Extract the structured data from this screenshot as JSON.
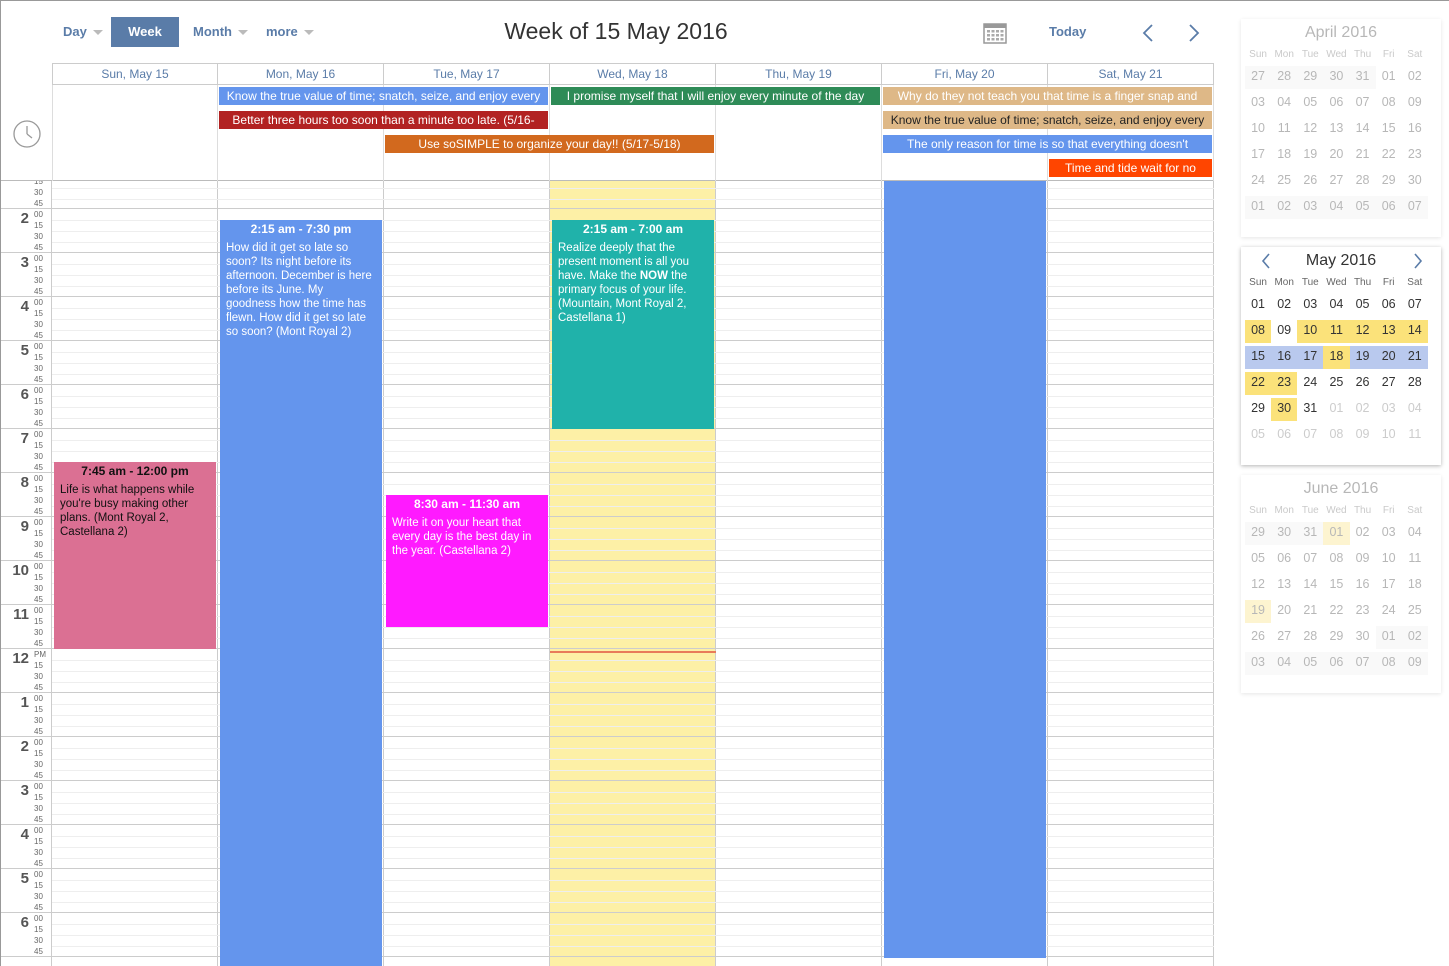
{
  "toolbar": {
    "day": "Day",
    "week": "Week",
    "month": "Month",
    "more": "more",
    "title": "Week of 15 May 2016",
    "today": "Today"
  },
  "day_headers": [
    "Sun, May 15",
    "Mon, May 16",
    "Tue, May 17",
    "Wed, May 18",
    "Thu, May 19",
    "Fri, May 20",
    "Sat, May 21"
  ],
  "allday_events": [
    {
      "text": "Know the true value of time; snatch, seize, and enjoy every",
      "color": "#6495ed"
    },
    {
      "text": "I promise myself that I will enjoy every minute of the day",
      "color": "#2e8b57"
    },
    {
      "text": "Why do they not teach you that time is a finger snap and",
      "color": "#deb887"
    },
    {
      "text": "Better three hours too soon than a minute too late. (5/16-",
      "color": "#b22222"
    },
    {
      "text": "Know the true value of time; snatch, seize, and enjoy every",
      "color": "#deb887"
    },
    {
      "text": "Use soSIMPLE to organize your day!! (5/17-5/18)",
      "color": "#d2691e"
    },
    {
      "text": "The only reason for time is so that everything doesn't",
      "color": "#6495ed"
    },
    {
      "text": "Time and tide wait for no",
      "color": "#ff4500"
    }
  ],
  "time_labels": {
    "hours": [
      "2",
      "3",
      "4",
      "5",
      "6",
      "7",
      "8",
      "9",
      "10",
      "11",
      "12",
      "1",
      "2",
      "3",
      "4",
      "5",
      "6"
    ],
    "pm": "PM",
    "minutes": [
      "00",
      "15",
      "30",
      "45"
    ]
  },
  "timed_events": [
    {
      "time": "7:45 am - 12:00 pm",
      "desc": "Life is what happens while you're busy making other plans. (Mont Royal 2, Castellana 2)",
      "color": "#db7093"
    },
    {
      "time": "2:15 am - 7:30 pm",
      "desc": "How did it get so late so soon? Its night before its afternoon. December is here before its June. My goodness how the time has flewn. How did it get so late so soon? (Mont Royal 2)",
      "color": "#6495ed"
    },
    {
      "time": "8:30 am - 11:30 am",
      "desc": "Write it on your heart that every day is the best day in the year. (Castellana 2)",
      "color": "#ff1aff"
    },
    {
      "time": "2:15 am - 7:00 am",
      "desc_pre": "Realize deeply that the present moment is all you have. Make the ",
      "desc_bold": "NOW",
      "desc_post": " the primary focus of your life. (Mountain, Mont Royal 2, Castellana 1)",
      "color": "#20b2aa"
    },
    {
      "color": "#6495ed"
    }
  ],
  "mini_calendars": {
    "dow": [
      "Sun",
      "Mon",
      "Tue",
      "Wed",
      "Thu",
      "Fri",
      "Sat"
    ],
    "april": {
      "title": "April 2016",
      "weeks": [
        [
          "27",
          "28",
          "29",
          "30",
          "31",
          "01",
          "02"
        ],
        [
          "03",
          "04",
          "05",
          "06",
          "07",
          "08",
          "09"
        ],
        [
          "10",
          "11",
          "12",
          "13",
          "14",
          "15",
          "16"
        ],
        [
          "17",
          "18",
          "19",
          "20",
          "21",
          "22",
          "23"
        ],
        [
          "24",
          "25",
          "26",
          "27",
          "28",
          "29",
          "30"
        ],
        [
          "01",
          "02",
          "03",
          "04",
          "05",
          "06",
          "07"
        ]
      ]
    },
    "may": {
      "title": "May 2016",
      "weeks": [
        [
          "01",
          "02",
          "03",
          "04",
          "05",
          "06",
          "07"
        ],
        [
          "08",
          "09",
          "10",
          "11",
          "12",
          "13",
          "14"
        ],
        [
          "15",
          "16",
          "17",
          "18",
          "19",
          "20",
          "21"
        ],
        [
          "22",
          "23",
          "24",
          "25",
          "26",
          "27",
          "28"
        ],
        [
          "29",
          "30",
          "31",
          "01",
          "02",
          "03",
          "04"
        ],
        [
          "05",
          "06",
          "07",
          "08",
          "09",
          "10",
          "11"
        ]
      ]
    },
    "june": {
      "title": "June 2016",
      "weeks": [
        [
          "29",
          "30",
          "31",
          "01",
          "02",
          "03",
          "04"
        ],
        [
          "05",
          "06",
          "07",
          "08",
          "09",
          "10",
          "11"
        ],
        [
          "12",
          "13",
          "14",
          "15",
          "16",
          "17",
          "18"
        ],
        [
          "19",
          "20",
          "21",
          "22",
          "23",
          "24",
          "25"
        ],
        [
          "26",
          "27",
          "28",
          "29",
          "30",
          "01",
          "02"
        ],
        [
          "03",
          "04",
          "05",
          "06",
          "07",
          "08",
          "09"
        ]
      ]
    }
  },
  "colors": {
    "accent": "#5a7ca8",
    "today_bg": "#fdf0a6",
    "event_day_highlight": "#fbe27a",
    "week_highlight": "#b9c9ee",
    "now_line": "#e87b5a"
  }
}
